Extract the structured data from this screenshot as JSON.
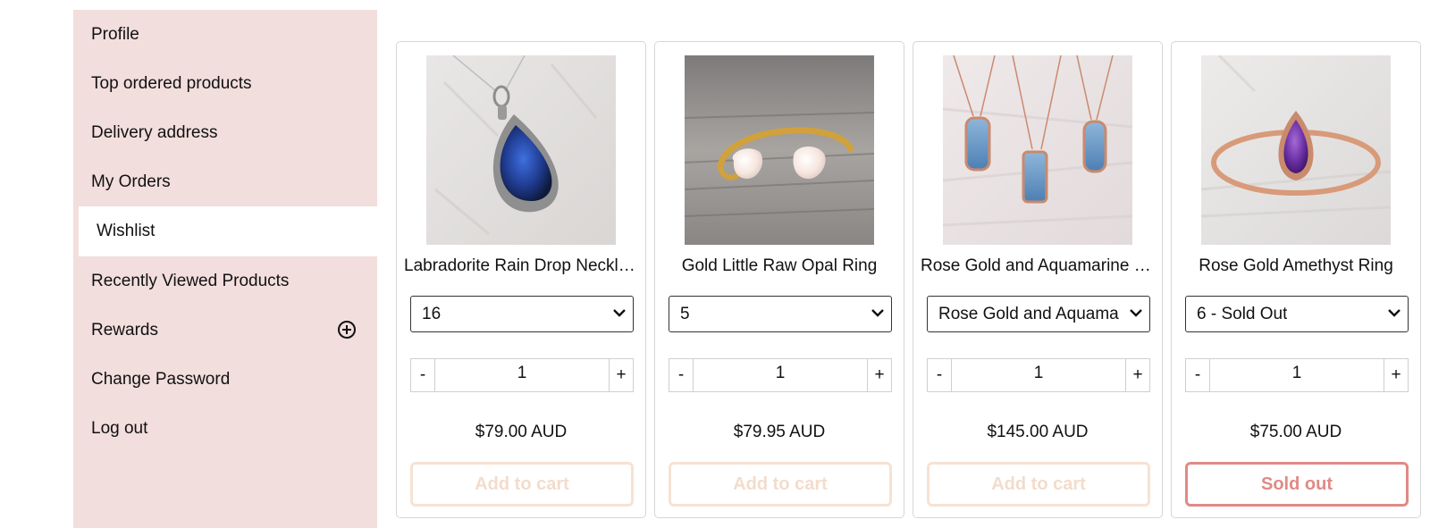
{
  "sidebar": {
    "items": [
      {
        "label": "Profile"
      },
      {
        "label": "Top ordered products"
      },
      {
        "label": "Delivery address"
      },
      {
        "label": "My Orders"
      },
      {
        "label": "Wishlist"
      },
      {
        "label": "Recently Viewed Products"
      },
      {
        "label": "Rewards",
        "icon": "plus-circle-icon"
      },
      {
        "label": "Change Password"
      },
      {
        "label": "Log out"
      }
    ],
    "active": "Wishlist",
    "background_color": "#f2dedd"
  },
  "wishlist": {
    "products": [
      {
        "name": "Labradorite Rain Drop Necklace",
        "variant": "16",
        "quantity": "1",
        "price": "$79.00 AUD",
        "button": "Add to cart",
        "minus": "-",
        "plus": "+",
        "image": "labradorite-pendant-image"
      },
      {
        "name": "Gold Little Raw Opal Ring",
        "variant": "5",
        "quantity": "1",
        "price": "$79.95 AUD",
        "button": "Add to cart",
        "minus": "-",
        "plus": "+",
        "image": "gold-opal-ring-image"
      },
      {
        "name": "Rose Gold and Aquamarine Necklace",
        "variant": "Rose Gold and Aquamarine",
        "quantity": "1",
        "price": "$145.00 AUD",
        "button": "Add to cart",
        "minus": "-",
        "plus": "+",
        "image": "aquamarine-necklaces-image"
      },
      {
        "name": "Rose Gold Amethyst Ring",
        "variant": "6 - Sold Out",
        "quantity": "1",
        "price": "$75.00 AUD",
        "button": "Sold out",
        "minus": "-",
        "plus": "+",
        "image": "amethyst-ring-image"
      }
    ]
  },
  "colors": {
    "add_to_cart": "#f3dccc",
    "sold_out": "#e08a86"
  }
}
